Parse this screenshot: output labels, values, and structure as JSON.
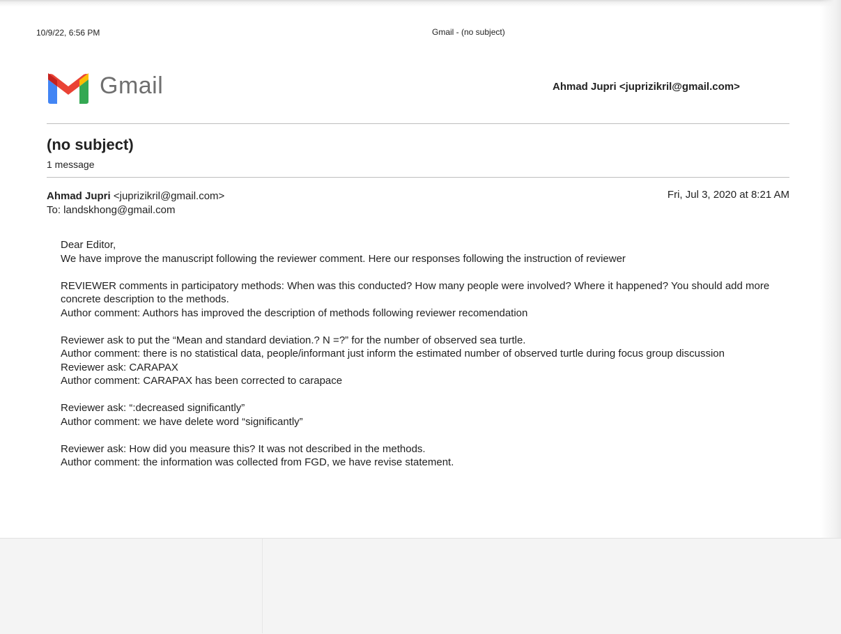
{
  "print_header": {
    "datetime": "10/9/22, 6:56 PM",
    "title": "Gmail - (no subject)"
  },
  "logo": {
    "icon": "gmail-m-icon",
    "text": "Gmail"
  },
  "account": "Ahmad Jupri <juprizikril@gmail.com>",
  "thread": {
    "subject": "(no subject)",
    "count": "1 message"
  },
  "message": {
    "from_name": "Ahmad Jupri",
    "from_email": "<juprizikril@gmail.com>",
    "to": "To: landskhong@gmail.com",
    "date": "Fri, Jul 3, 2020 at 8:21 AM",
    "paragraphs": [
      [
        "Dear Editor,",
        "We have improve the manuscript following the reviewer comment. Here our responses following the instruction of reviewer"
      ],
      [
        "REVIEWER comments in participatory methods: When was this conducted? How many people were involved? Where it happened? You should add more concrete description to the methods.",
        "Author comment: Authors has improved the description of methods following reviewer recomendation"
      ],
      [
        "Reviewer ask to put the “Mean and standard deviation.? N =?” for the number of observed sea turtle.",
        "Author comment: there is no statistical data, people/informant just inform the estimated number of observed turtle during focus group discussion",
        "Reviewer ask: CARAPAX",
        "Author comment: CARAPAX has been corrected to carapace"
      ],
      [
        "Reviewer ask: “:decreased significantly”",
        "Author comment: we have delete word “significantly”"
      ],
      [
        "Reviewer ask: How did you measure this? It was not described in the methods.",
        "Author comment: the information was collected from FGD, we have revise statement."
      ]
    ]
  },
  "colors": {
    "logo_red": "#ea4335",
    "logo_blue": "#4285f4",
    "logo_green": "#34a853",
    "logo_yellow": "#fbbc04",
    "logo_darkred": "#c5221f",
    "rule": "#bdbdbd"
  }
}
